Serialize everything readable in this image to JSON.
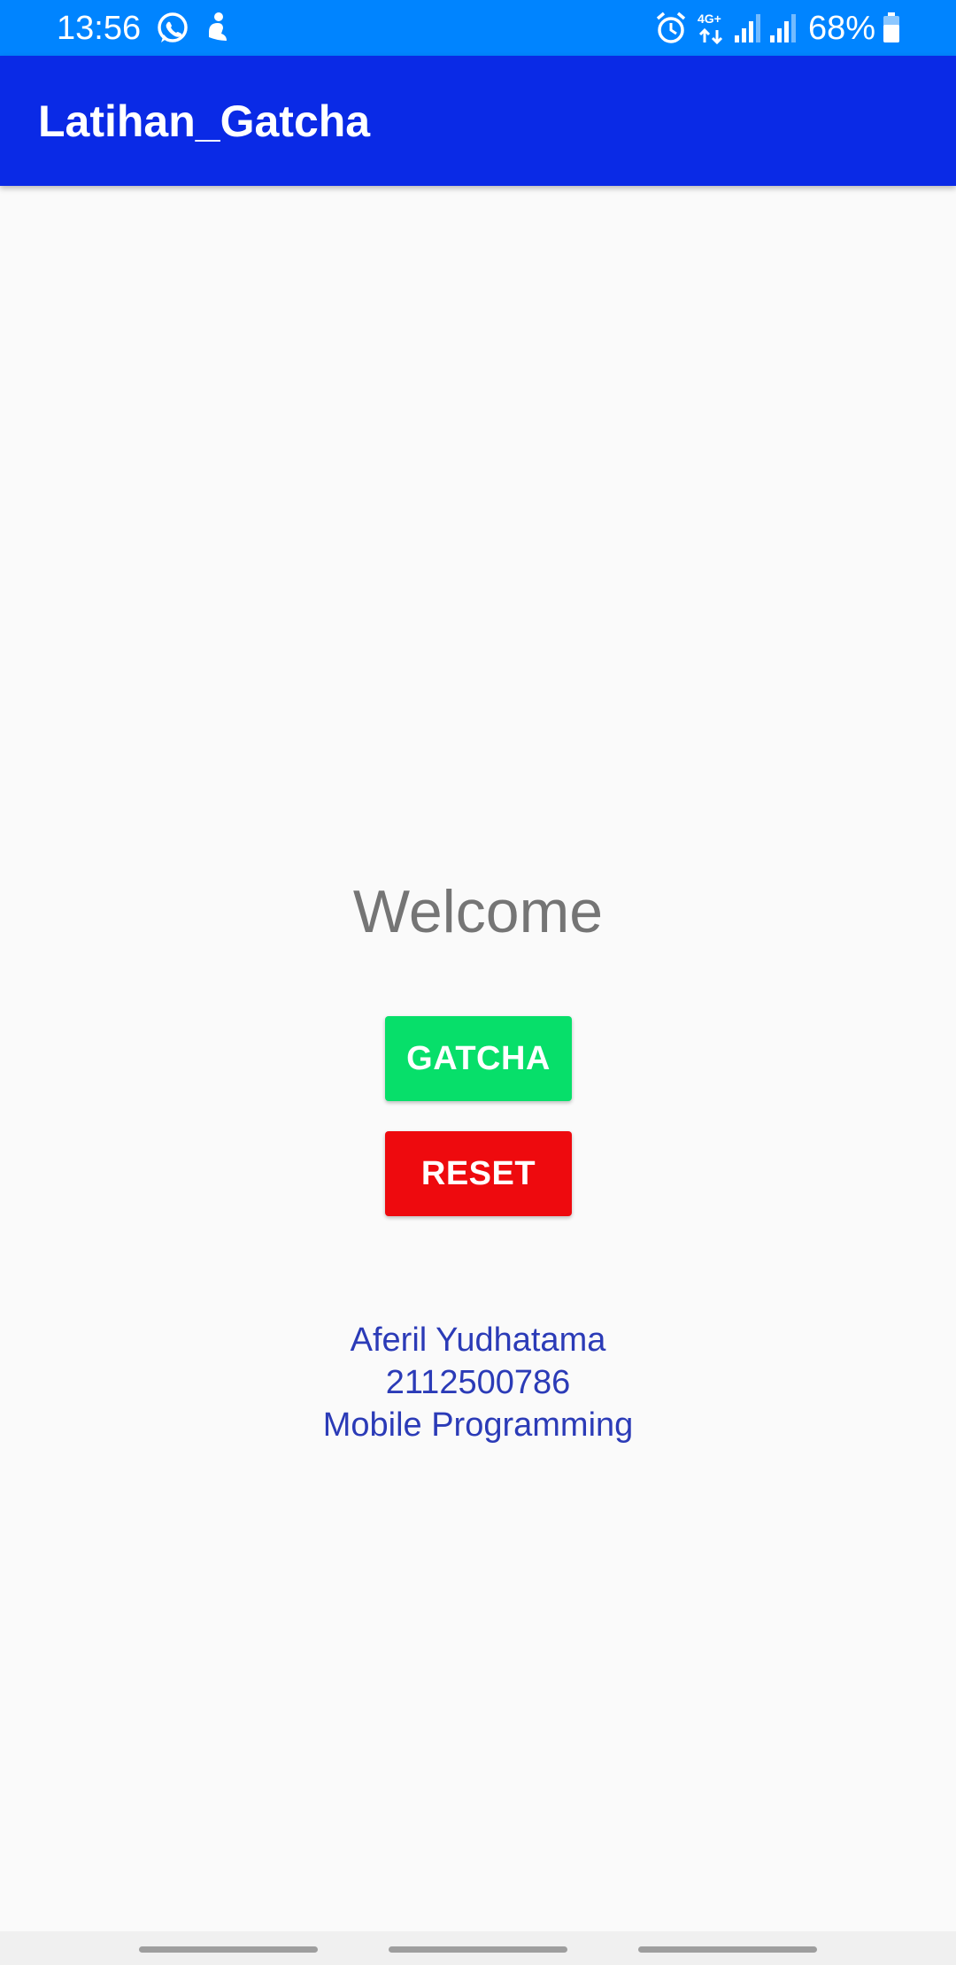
{
  "status_bar": {
    "time": "13:56",
    "battery_percent": "68%",
    "network": "4G+",
    "icons": [
      "whatsapp-icon",
      "notification-person-icon",
      "alarm-icon",
      "network-4g-icon",
      "signal-icon",
      "signal-icon",
      "battery-icon"
    ]
  },
  "app_bar": {
    "title": "Latihan_Gatcha"
  },
  "main": {
    "welcome_text": "Welcome",
    "gatcha_label": "GATCHA",
    "reset_label": "RESET",
    "info_lines": [
      "Aferil Yudhatama",
      "2112500786",
      "Mobile Programming"
    ]
  },
  "colors": {
    "status_bar": "#0084ff",
    "app_bar": "#0a2ae6",
    "gatcha_button": "#07df6a",
    "reset_button": "#ee0a0e",
    "info_text": "#2b3bb7"
  }
}
